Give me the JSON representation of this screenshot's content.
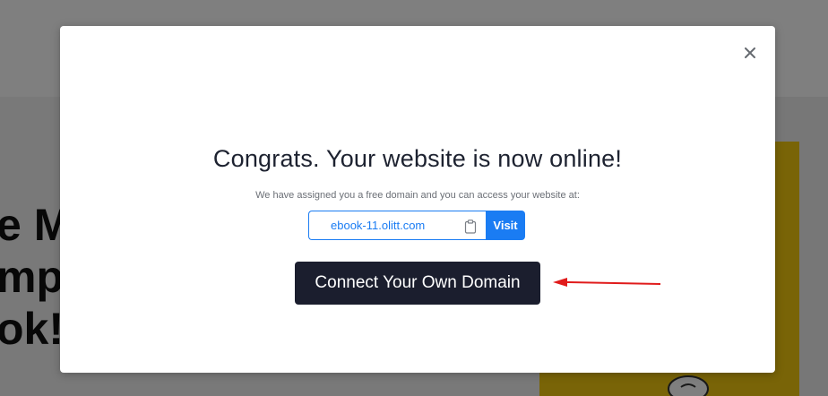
{
  "background": {
    "hero_lines": "e M\nmpr\nok!"
  },
  "modal": {
    "close_label": "×",
    "title": "Congrats. Your website is now online!",
    "subtitle": "We have assigned you a free domain and you can access your website at:",
    "domain": "ebook-11.olitt.com",
    "visit_label": "Visit",
    "connect_label": "Connect Your Own Domain"
  },
  "colors": {
    "accent": "#1a7cf3",
    "dark_button": "#1b1e2e",
    "annotation_arrow": "#e01b1b",
    "background_panel": "#f2c80f"
  },
  "icons": [
    "close-icon",
    "clipboard-icon",
    "arrow-annotation"
  ]
}
